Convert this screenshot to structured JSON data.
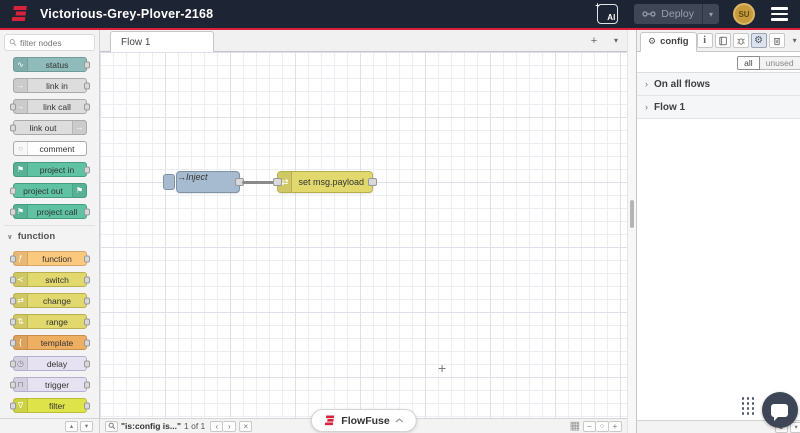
{
  "header": {
    "title": "Victorious-Grey-Plover-2168",
    "ai_button": "AI",
    "deploy_button": "Deploy",
    "avatar_initials": "SU",
    "background": "#1d2433",
    "accent_red": "#d8213a"
  },
  "icons": {
    "sparkle": "+",
    "caret_down": "▾",
    "caret_up": "▴",
    "chevron_left": "‹",
    "chevron_right": "›",
    "close": "×",
    "plus": "+",
    "minus": "−",
    "zoom_reset": "○",
    "map": "▦",
    "category_expanded": "∨",
    "section_collapsed": "›",
    "gear": "⚙",
    "info": "i",
    "cursor_plus": "+"
  },
  "palette": {
    "filter_placeholder": "filter nodes",
    "sections": [
      {
        "label": "",
        "items": [
          {
            "label": "status",
            "color": "#8fbcba",
            "border_color": "#6f9b99",
            "icon_glyph": "∿"
          },
          {
            "label": "link in",
            "color": "#dddddd",
            "border_color": "#a9a9a9",
            "icon_glyph": "→"
          },
          {
            "label": "link call",
            "color": "#dddddd",
            "border_color": "#a9a9a9",
            "icon_glyph": "→"
          },
          {
            "label": "link out",
            "color": "#dddddd",
            "border_color": "#a9a9a9",
            "icon_glyph": "→"
          },
          {
            "label": "comment",
            "color": "#ffffff",
            "border_color": "#aaaaaa",
            "icon_glyph": "○"
          },
          {
            "label": "project in",
            "color": "#5fc2a2",
            "border_color": "#459c80",
            "icon_glyph": "⚑"
          },
          {
            "label": "project out",
            "color": "#5fc2a2",
            "border_color": "#459c80",
            "icon_glyph": "⚑"
          },
          {
            "label": "project call",
            "color": "#5fc2a2",
            "border_color": "#459c80",
            "icon_glyph": "⚑"
          }
        ]
      },
      {
        "label": "function",
        "items": [
          {
            "label": "function",
            "color": "#fbc97e",
            "border_color": "#d9a668",
            "icon_glyph": "ƒ"
          },
          {
            "label": "switch",
            "color": "#e2d96e",
            "border_color": "#b8b04e",
            "icon_glyph": "≺"
          },
          {
            "label": "change",
            "color": "#e2d96e",
            "border_color": "#b8b04e",
            "icon_glyph": "⇄"
          },
          {
            "label": "range",
            "color": "#e2d96e",
            "border_color": "#b8b04e",
            "icon_glyph": "⇅"
          },
          {
            "label": "template",
            "color": "#efaf63",
            "border_color": "#c98d4a",
            "icon_glyph": "{"
          },
          {
            "label": "delay",
            "color": "#e7e2f2",
            "border_color": "#b3aed0",
            "icon_glyph": "◷"
          },
          {
            "label": "trigger",
            "color": "#e7e2f2",
            "border_color": "#b3aed0",
            "icon_glyph": "⊓"
          },
          {
            "label": "filter",
            "color": "#dfe34a",
            "border_color": "#b9bd3a",
            "icon_glyph": "∇"
          }
        ]
      }
    ]
  },
  "workspace": {
    "tab": "Flow 1",
    "nodes": {
      "inject": {
        "label": "Inject",
        "color": "#a6bbcf",
        "border_color": "#7d92a5",
        "icon_glyph": "→"
      },
      "change": {
        "label": "set msg.payload",
        "color": "#e2d96e",
        "border_color": "#b8b04e",
        "icon_glyph": "⇄"
      }
    },
    "footer": {
      "search_query": "\"is:config is...\"",
      "search_count": "1 of 1"
    }
  },
  "flowfuse_button": {
    "label": "FlowFuse"
  },
  "sidebar": {
    "tab_label": "config",
    "filter_all": "all",
    "filter_unused": "unused",
    "sections": [
      {
        "label": "On all flows"
      },
      {
        "label": "Flow 1"
      }
    ]
  }
}
